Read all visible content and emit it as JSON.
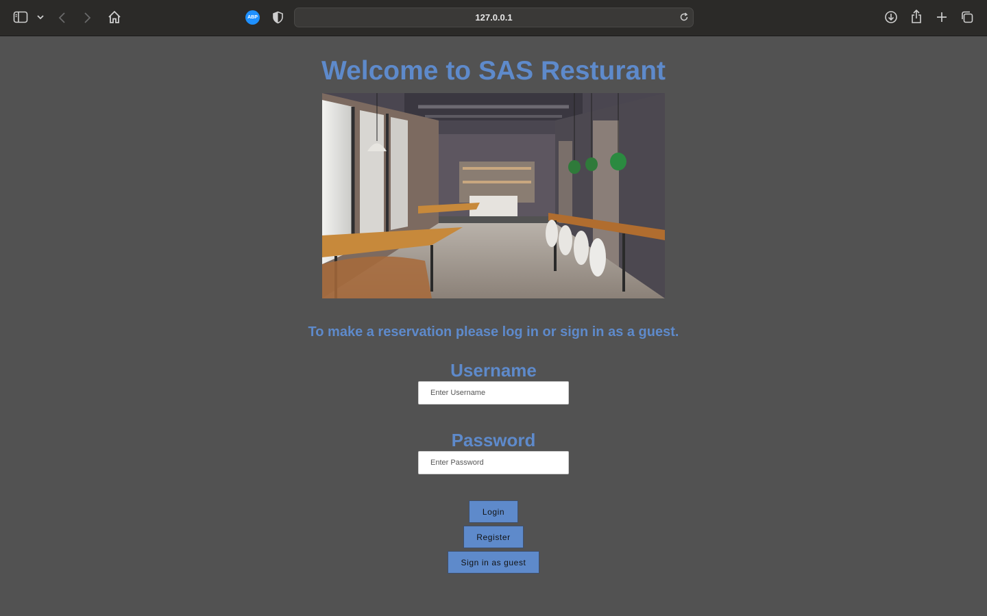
{
  "browser": {
    "url": "127.0.0.1",
    "extension_badge": "ABP",
    "icons": [
      "sidebar-icon",
      "chevron-down-icon",
      "back-icon",
      "forward-icon",
      "home-icon",
      "shield-icon",
      "reload-icon",
      "download-icon",
      "share-icon",
      "new-tab-icon",
      "tabs-overview-icon"
    ]
  },
  "page": {
    "title": "Welcome to SAS Resturant",
    "subtitle": "To make a reservation please log in or sign in as a guest."
  },
  "form": {
    "username_label": "Username",
    "username_placeholder": "Enter Username",
    "username_value": "",
    "password_label": "Password",
    "password_placeholder": "Enter Password",
    "password_value": ""
  },
  "buttons": {
    "login": "Login",
    "register": "Register",
    "guest": "Sign in as guest"
  },
  "colors": {
    "accent": "#5e8acb",
    "page_bg": "#525252",
    "toolbar_bg": "#2b2a28"
  }
}
